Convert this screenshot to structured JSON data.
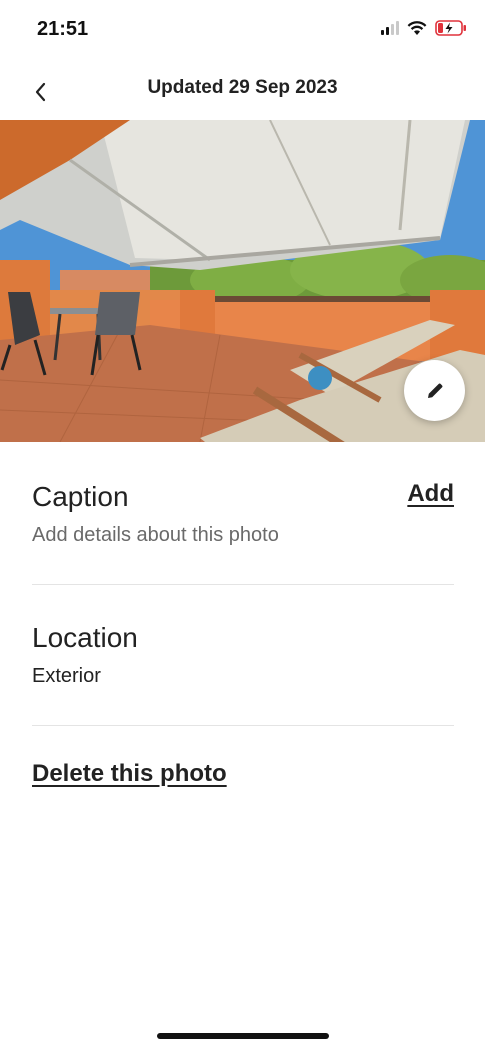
{
  "status_bar": {
    "time": "21:51"
  },
  "header": {
    "title": "Updated 29 Sep 2023"
  },
  "photo": {
    "description_icon": "terrace-photo",
    "edit_icon": "pencil-icon"
  },
  "caption": {
    "title": "Caption",
    "subtitle": "Add details about this photo",
    "action": "Add"
  },
  "location": {
    "title": "Location",
    "value": "Exterior"
  },
  "actions": {
    "delete": "Delete this photo"
  },
  "colors": {
    "text": "#222222",
    "muted": "#6a6a6a",
    "divider": "#e4e4e4",
    "battery_charging": "#e0323b"
  }
}
